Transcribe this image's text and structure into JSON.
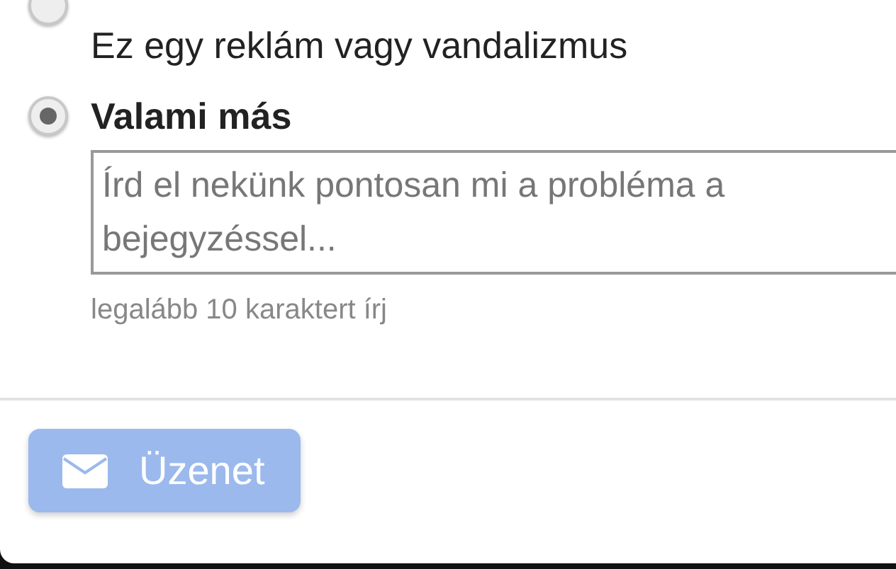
{
  "options": [
    {
      "description": "Ez egy reklám vagy vandalizmus",
      "selected": false
    },
    {
      "label": "Valami más",
      "selected": true
    }
  ],
  "message_field": {
    "placeholder": "Írd el nekünk pontosan mi a probléma a bejegyzéssel...",
    "hint": "legalább 10 karaktert írj"
  },
  "submit_button": {
    "label": "Üzenet",
    "disabled": true
  }
}
